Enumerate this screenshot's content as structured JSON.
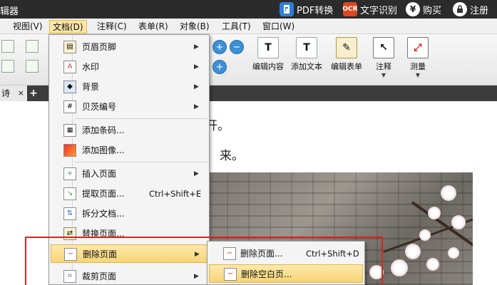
{
  "title_bar": {
    "app_title": "辑器",
    "actions": [
      {
        "label": "PDF转换",
        "icon": "pdf-convert-icon",
        "color": "#2f7fd6"
      },
      {
        "label": "文字识别",
        "icon": "ocr-icon",
        "icon_text": "OCR",
        "color": "#d9481f"
      },
      {
        "label": "购买",
        "icon": "yen-icon",
        "icon_text": "¥",
        "color": "#555555"
      },
      {
        "label": "注册",
        "icon": "lock-icon",
        "color": "#555555"
      }
    ]
  },
  "menu_bar": {
    "items": [
      "视图(V)",
      "文档(D)",
      "注释(C)",
      "表单(R)",
      "对象(B)",
      "工具(T)",
      "窗口(W)"
    ],
    "active": "文档(D)"
  },
  "toolbar": {
    "buttons": [
      {
        "label": "编辑内容",
        "icon": "edit-content-icon"
      },
      {
        "label": "添加文本",
        "icon": "add-text-icon"
      },
      {
        "label": "编辑表单",
        "icon": "edit-form-icon"
      },
      {
        "label": "注释",
        "icon": "comment-icon"
      },
      {
        "label": "测量",
        "icon": "measure-icon"
      }
    ]
  },
  "tab": {
    "label": "诗",
    "close_symbol": "×",
    "new_tab_symbol": "+"
  },
  "document": {
    "line1_visible": "开。",
    "line2_visible": "来。"
  },
  "doc_menu": {
    "items": [
      {
        "label": "页眉页脚",
        "icon": "header-footer-icon",
        "submenu": true
      },
      {
        "label": "水印",
        "icon": "watermark-icon",
        "submenu": true
      },
      {
        "label": "背景",
        "icon": "background-icon",
        "submenu": true
      },
      {
        "label": "贝茨编号",
        "icon": "bates-numbering-icon",
        "submenu": true
      },
      {
        "label": "添加条码...",
        "icon": "barcode-icon"
      },
      {
        "label": "添加图像...",
        "icon": "add-image-icon"
      },
      {
        "label": "插入页面",
        "icon": "insert-page-icon",
        "submenu": true
      },
      {
        "label": "提取页面...",
        "icon": "extract-page-icon",
        "shortcut": "Ctrl+Shift+E"
      },
      {
        "label": "拆分文档...",
        "icon": "split-document-icon"
      },
      {
        "label": "替换页面...",
        "icon": "replace-page-icon"
      },
      {
        "label": "删除页面",
        "icon": "delete-page-icon",
        "submenu": true,
        "highlighted": true
      },
      {
        "label": "裁剪页面",
        "icon": "crop-page-icon",
        "submenu": true
      }
    ]
  },
  "sub_menu": {
    "items": [
      {
        "label": "删除页面...",
        "icon": "delete-pages-icon",
        "shortcut": "Ctrl+Shift+D"
      },
      {
        "label": "删除空白页...",
        "icon": "delete-blank-pages-icon",
        "highlighted": true
      }
    ]
  },
  "colors": {
    "highlight": "#f7d477",
    "annotation_frame": "#e0201a"
  }
}
